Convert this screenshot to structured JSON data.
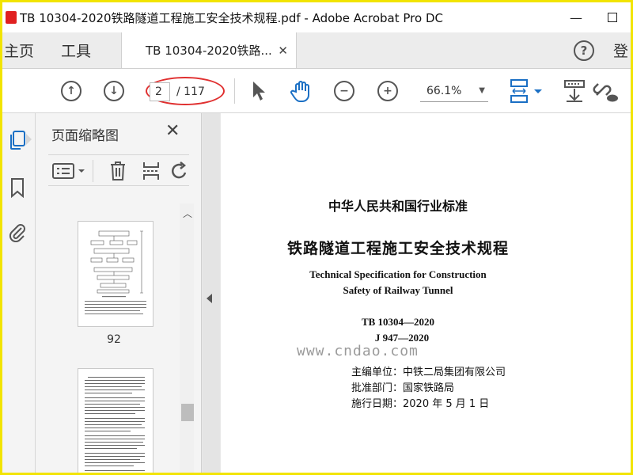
{
  "window": {
    "title": "TB 10304-2020铁路隧道工程施工安全技术规程.pdf - Adobe Acrobat Pro DC"
  },
  "tabs": {
    "home": "主页",
    "tools": "工具",
    "document": "TB 10304-2020铁路...",
    "login": "登"
  },
  "toolbar": {
    "current_page": "2",
    "total_pages": "/ 117",
    "zoom": "66.1%"
  },
  "panel": {
    "title": "页面缩略图",
    "thumbnails": [
      {
        "label": "92"
      },
      {
        "label": ""
      }
    ]
  },
  "document": {
    "standard_type": "中华人民共和国行业标准",
    "title_cn": "铁路隧道工程施工安全技术规程",
    "title_en_line1": "Technical Specification for Construction",
    "title_en_line2": "Safety of Railway Tunnel",
    "code1": "TB 10304—2020",
    "code2": "J 947—2020",
    "editor": "主编单位：中铁二局集团有限公司",
    "approver": "批准部门：国家铁路局",
    "effective_date": "施行日期：2020 年 5 月 1 日"
  },
  "watermark": "www.cndao.com"
}
